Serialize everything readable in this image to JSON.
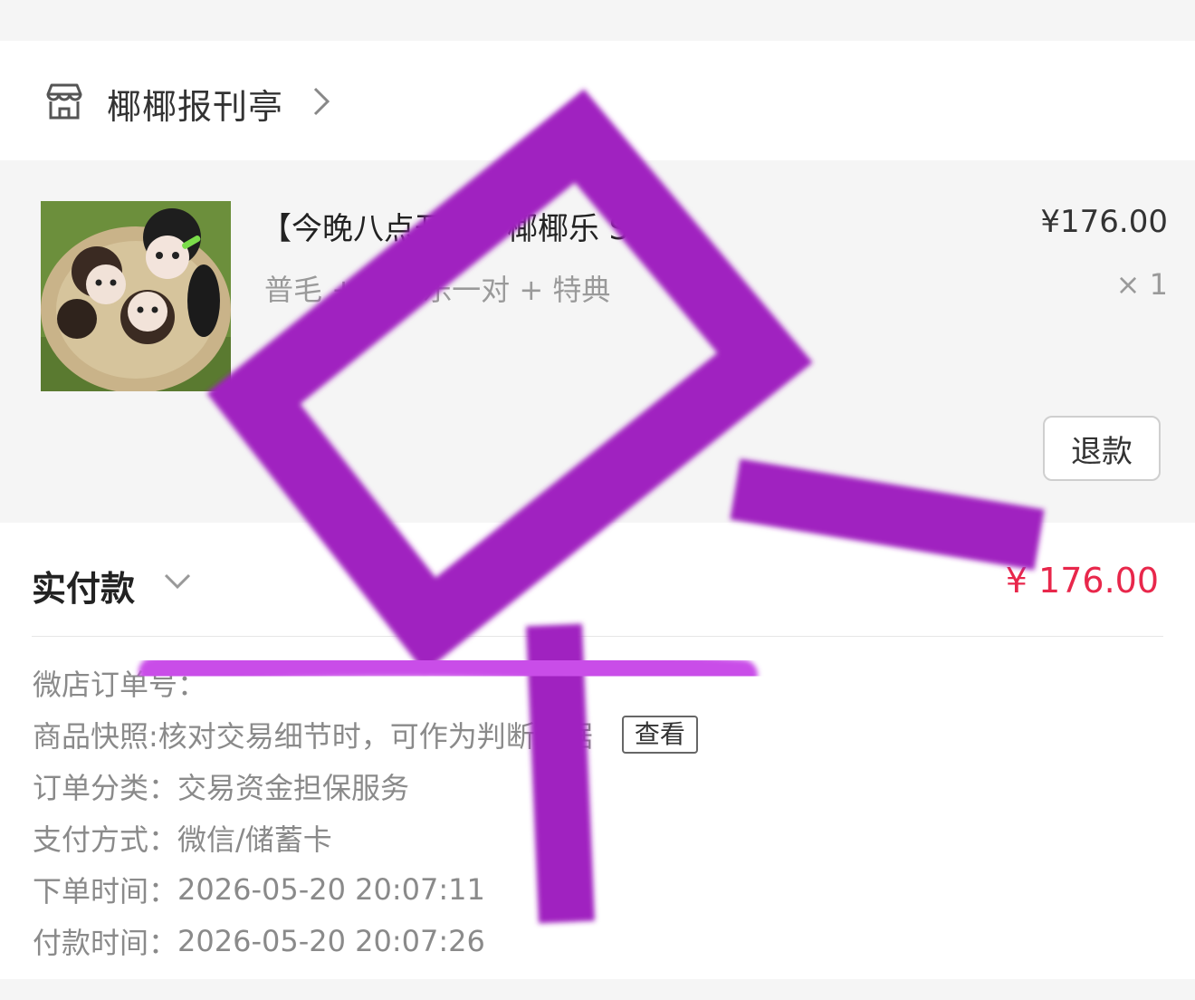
{
  "shop": {
    "name": "椰椰报刊亭",
    "icon": "store-icon",
    "chevron_icon": "chevron-right-icon"
  },
  "goods": {
    "title": "【今晚八点开团】椰椰乐 S",
    "sku": "普毛 + 椰椰乐一对 + 特典",
    "price": "¥176.00",
    "quantity": "× 1",
    "refund_label": "退款"
  },
  "payment": {
    "paid_label": "实付款",
    "paid_amount": "¥ 176.00",
    "amount_color": "#e8274b"
  },
  "order_info": {
    "order_no_label": "微店订单号：",
    "snapshot_label": "商品快照: ",
    "snapshot_value": "核对交易细节时，可作为判断依据",
    "snapshot_button": "查看",
    "category_label": "订单分类：",
    "category_value": "交易资金担保服务",
    "pay_method_label": "支付方式：",
    "pay_method_value": "微信/储蓄卡",
    "order_time_label": "下单时间：",
    "order_time_value": "2026-05-20 20:07:11",
    "pay_time_label": "付款时间：",
    "pay_time_value": "2026-05-20 20:07:26"
  },
  "annotation_color": "#a020c0"
}
